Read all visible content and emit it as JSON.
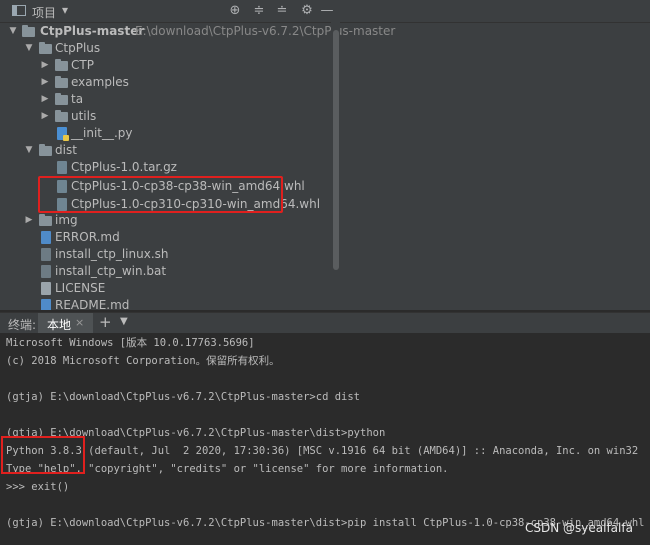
{
  "project_panel": {
    "title": "项目",
    "dropdown": "▾",
    "toolbar_icons": [
      "crosshair-icon",
      "expand-all-icon",
      "collapse-all-icon",
      "gear-icon",
      "minimize-icon"
    ]
  },
  "tree": {
    "root": {
      "name": "CtpPlus-master",
      "path": "E:\\download\\CtpPlus-v6.7.2\\CtpPlus-master"
    },
    "ctpplus_folder": "CtpPlus",
    "ctp": "CTP",
    "examples": "examples",
    "ta": "ta",
    "utils": "utils",
    "init_py": "__init__.py",
    "dist": "dist",
    "tar": "CtpPlus-1.0.tar.gz",
    "whl38": "CtpPlus-1.0-cp38-cp38-win_amd64.whl",
    "whl310": "CtpPlus-1.0-cp310-cp310-win_amd64.whl",
    "img": "img",
    "error_md": "ERROR.md",
    "linux_sh": "install_ctp_linux.sh",
    "win_bat": "install_ctp_win.bat",
    "license": "LICENSE",
    "readme": "README.md"
  },
  "terminal_bar": {
    "title": "终端:",
    "tab_label": "本地",
    "close": "×",
    "add": "+",
    "more": "⌄"
  },
  "terminal": {
    "line1": "Microsoft Windows [版本 10.0.17763.5696]",
    "line2": "(c) 2018 Microsoft Corporation。保留所有权利。",
    "line3": "(gtja) E:\\download\\CtpPlus-v6.7.2\\CtpPlus-master>cd dist",
    "line4": "(gtja) E:\\download\\CtpPlus-v6.7.2\\CtpPlus-master\\dist>python",
    "line5": "Python 3.8.3 (default, Jul  2 2020, 17:30:36) [MSC v.1916 64 bit (AMD64)] :: Anaconda, Inc. on win32",
    "line6": "Type \"help\", \"copyright\", \"credits\" or \"license\" for more information.",
    "line7": ">>> exit()",
    "line8": "(gtja) E:\\download\\CtpPlus-v6.7.2\\CtpPlus-master\\dist>pip install CtpPlus-1.0-cp38-cp38-win_amd64.whl"
  },
  "watermark": "CSDN @syealfalfa",
  "colors": {
    "highlight": "#e0201e",
    "panel": "#3c3f41",
    "terminal_bg": "#2b2b2b"
  }
}
